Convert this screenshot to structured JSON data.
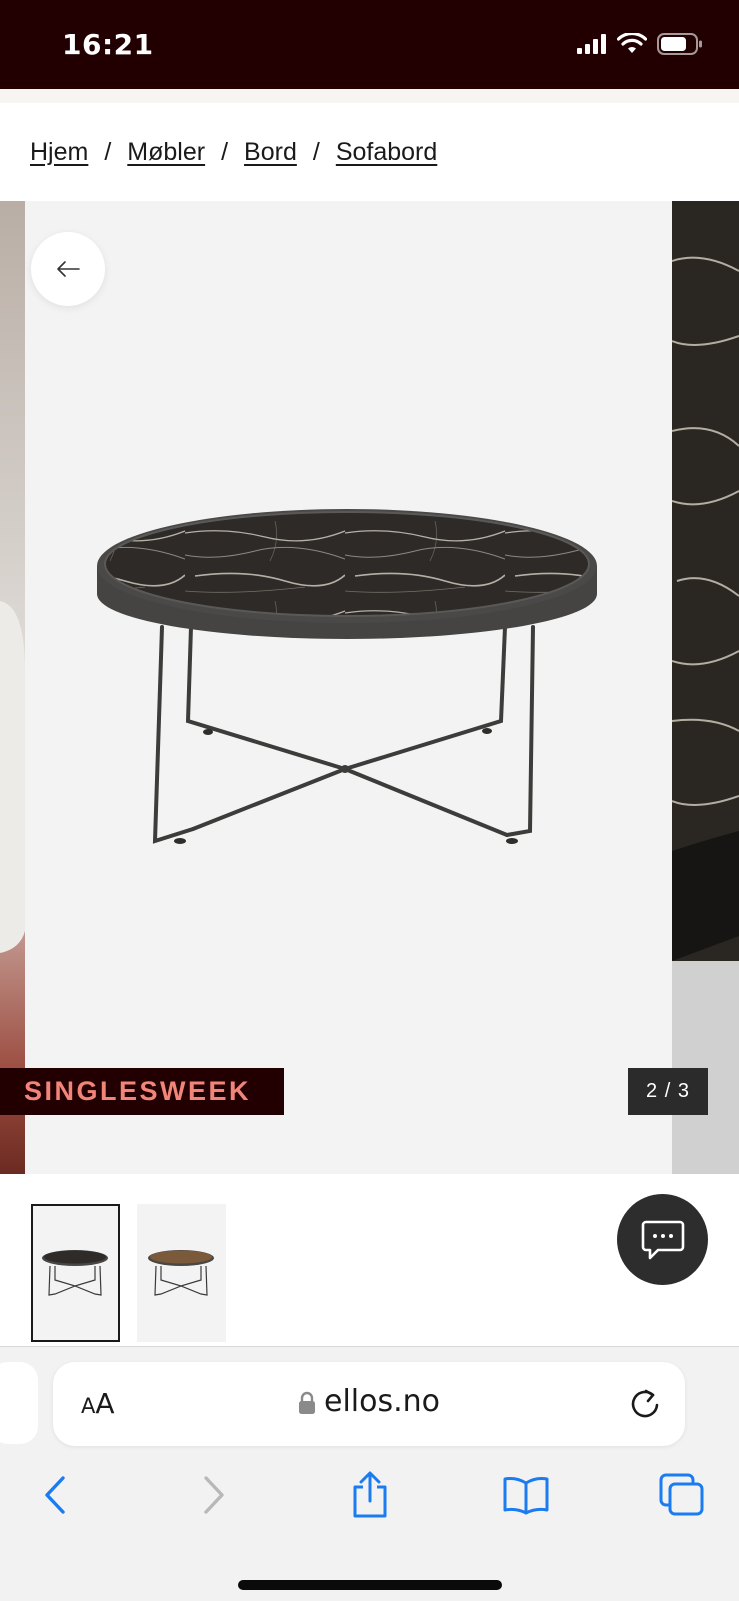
{
  "status_bar": {
    "time": "16:21"
  },
  "breadcrumb": {
    "items": [
      "Hjem",
      "Møbler",
      "Bord",
      "Sofabord"
    ],
    "separator": "/"
  },
  "gallery": {
    "promo_badge": "SINGLESWEEK",
    "counter": "2 / 3"
  },
  "browser": {
    "text_size_label_small": "A",
    "text_size_label_large": "A",
    "url": "ellos.no"
  },
  "icons": {
    "back": "arrow-left-icon",
    "chat": "chat-bubble-icon",
    "lock": "lock-icon",
    "reload": "reload-icon",
    "nav_back": "chevron-left-icon",
    "nav_forward": "chevron-right-icon",
    "share": "share-icon",
    "bookmarks": "book-icon",
    "tabs": "tabs-icon"
  },
  "colors": {
    "brand_dark": "#220002",
    "promo_text": "#f2857a",
    "safari_blue": "#1a7cf0"
  }
}
